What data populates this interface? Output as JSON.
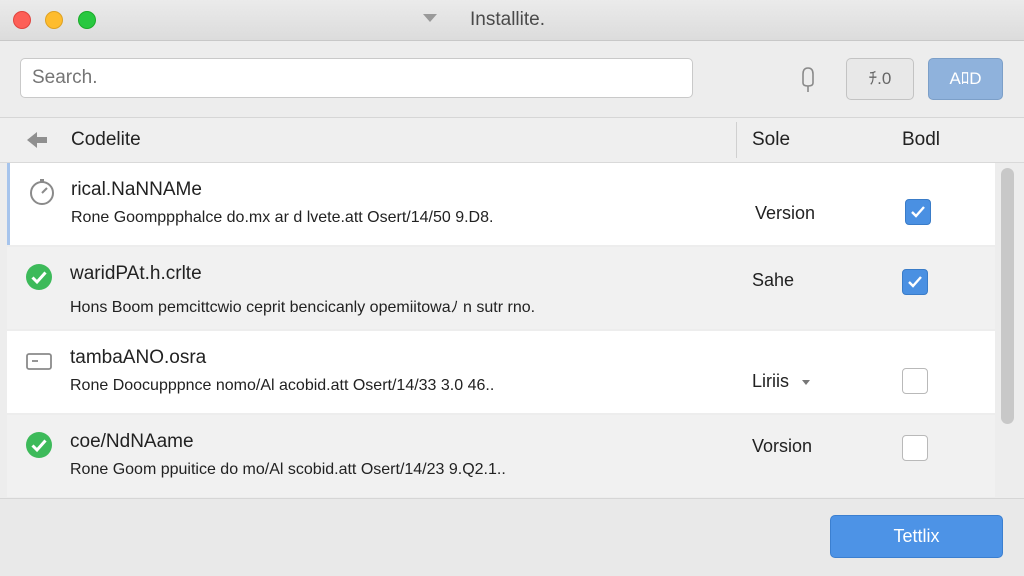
{
  "window": {
    "title": "Installite."
  },
  "toolbar": {
    "search_placeholder": "Search.",
    "secondary_button_label": "ﾁ.0",
    "add_button_label": "AﾛD"
  },
  "columns": {
    "name": "Codelite",
    "col2": "Sole",
    "col3": "Bodl"
  },
  "rows": [
    {
      "name": "rical.NaNNAMe",
      "desc": "Rone Goomppphalce do.mx ar d lvete.att Osert/14/50 9.D8.",
      "col2": "Version",
      "checked": true,
      "icon": "clock-icon"
    },
    {
      "name": "waridPAt.h.crlte",
      "desc": "Hons Boom pemcittcwio ceprit bencicanly opemiitowaﾉ n sutr rno.",
      "col2": "Sahe",
      "checked": true,
      "icon": "check-circle-icon"
    },
    {
      "name": "tambaANO.osra",
      "desc": "Rone Doocupppnce nomo/Al acobid.att Osert/14/33 3.0 46..",
      "col2": "Liriis",
      "checked": false,
      "icon": "window-icon",
      "has_dropdown": true
    },
    {
      "name": "coe/NdNAame",
      "desc": "Rone Goom ppuitice do mo/Al scobid.att Osert/14/23 9.Q2.1..",
      "col2": "Vorsion",
      "checked": false,
      "icon": "check-circle-icon"
    }
  ],
  "footer": {
    "primary_button_label": "Tettlix"
  },
  "colors": {
    "accent": "#4a90e2",
    "success": "#3dba5a",
    "selection": "#a6c4ec"
  }
}
